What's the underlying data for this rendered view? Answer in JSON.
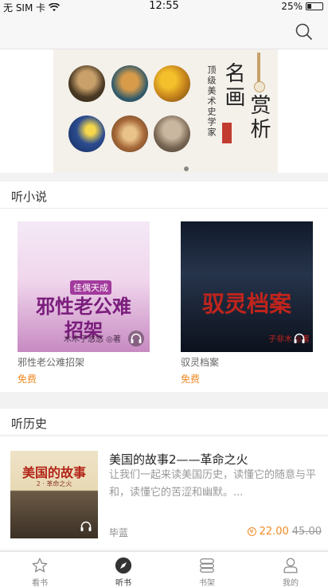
{
  "status_bar": {
    "carrier": "无 SIM 卡",
    "time": "12:55",
    "battery": "25%"
  },
  "banner": {
    "small_text": "顶级美术史学家",
    "title_line1": "名画",
    "title_line2": "赏析"
  },
  "sections": {
    "novels_title": "听小说",
    "history_title": "听历史"
  },
  "novels": [
    {
      "name": "邪性老公难招架",
      "price": "免费",
      "cover_title": "邪性老公难招架",
      "cover_tag": "佳偶天成",
      "cover_author": "木木子悠悠 ◎著"
    },
    {
      "name": "驭灵档案",
      "price": "免费",
      "cover_title": "驭灵档案",
      "cover_author": "子非木 ◎著"
    }
  ],
  "history_item": {
    "title": "美国的故事2——革命之火",
    "description": "让我们一起来读美国历史，读懂它的随意与平和，读懂它的苦涩和幽默。...",
    "author": "毕蓝",
    "price": "22.00",
    "original_price": "45.00",
    "cover_title": "美国的故事",
    "cover_subtitle": "2 · 革命之火"
  },
  "tabbar": {
    "items": [
      "看书",
      "听书",
      "书架",
      "我的"
    ],
    "active_index": 1
  },
  "colors": {
    "accent_orange": "#f08a24",
    "text_dark": "#222222",
    "text_gray": "#999999"
  },
  "icons": [
    "wifi-icon",
    "search-icon",
    "headphone-icon",
    "coin-icon",
    "star-icon",
    "compass-icon",
    "bookshelf-icon",
    "user-icon"
  ]
}
